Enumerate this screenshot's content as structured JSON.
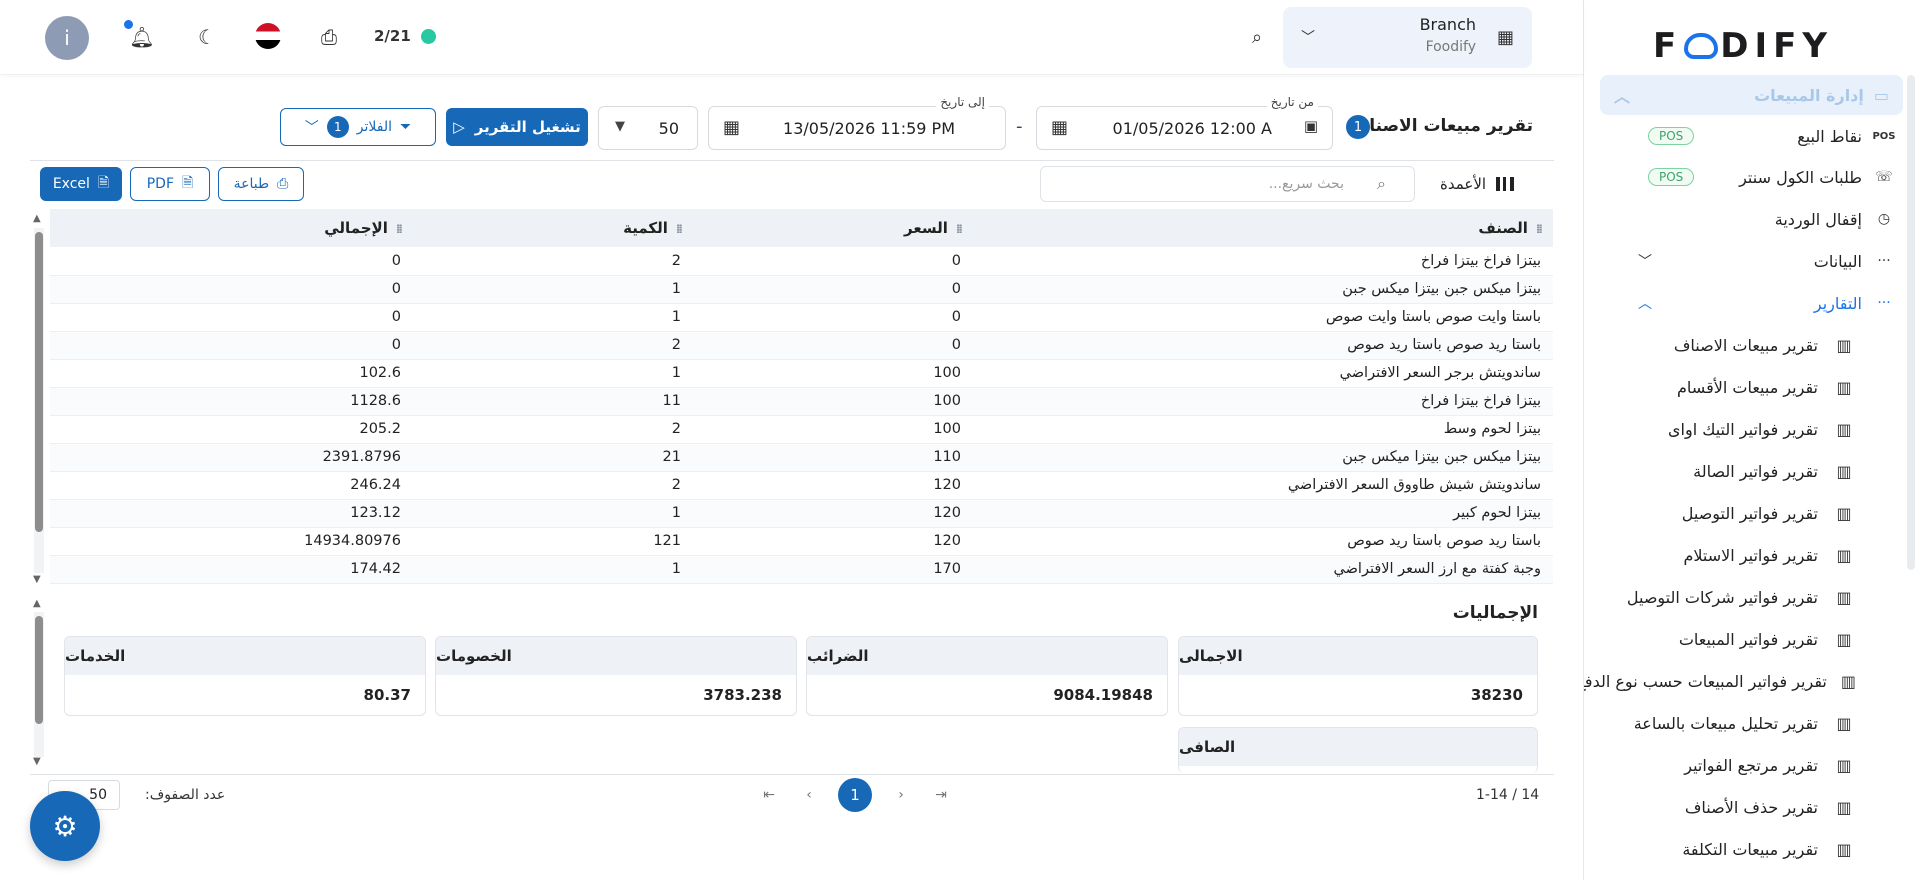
{
  "header": {
    "counter": "2/21",
    "branch_title": "Branch",
    "branch_sub": "Foodify",
    "avatar_letter": "i"
  },
  "sidebar": {
    "logo_left": "F",
    "logo_right": "DIFY",
    "section_label": "إدارة المبيعات",
    "items": [
      {
        "label": "نقاط البيع",
        "badge": "POS",
        "icon_text": "POS"
      },
      {
        "label": "طلبات الكول سنتر",
        "badge": "POS"
      },
      {
        "label": "إقفال الوردية"
      },
      {
        "label": "البيانات"
      },
      {
        "label": "التقارير"
      }
    ],
    "reports": [
      "تقرير مبيعات الاصناف",
      "تقرير مبيعات الأقسام",
      "تقرير فواتير التيك اواى",
      "تقرير فواتير الصالة",
      "تقرير فواتير التوصيل",
      "تقرير فواتير الاستلام",
      "تقرير فواتير شركات التوصيل",
      "تقرير فواتير المبيعات",
      "تقرير فواتير المبيعات حسب نوع الدفع",
      "تقرير تحليل مبيعات بالساعة",
      "تقرير مرتجع الفواتير",
      "تقرير حذف الأصناف",
      "تقرير مبيعات التكلفة"
    ]
  },
  "toolbar": {
    "page_title": "تقرير مبيعات الاصناف",
    "title_badge": "1",
    "from_label": "من تاريخ",
    "from_value": "01/05/2026 12:00 A",
    "to_label": "إلى تاريخ",
    "to_value": "13/05/2026 11:59 PM",
    "rows_value": "50",
    "run_label": "تشغيل التقرير",
    "filters_label": "الفلاتر",
    "filters_badge": "1"
  },
  "actions": {
    "excel": "Excel",
    "pdf": "PDF",
    "print": "طباعة",
    "search_placeholder": "بحث سريع...",
    "columns": "الأعمدة"
  },
  "table": {
    "headers": [
      "الصنف",
      "السعر",
      "الكمية",
      "الإجمالي"
    ],
    "rows": [
      [
        "بيتزا فراخ بيتزا فراخ",
        "0",
        "2",
        "0"
      ],
      [
        "بيتزا ميكس جبن بيتزا ميكس جبن",
        "0",
        "1",
        "0"
      ],
      [
        "باستا وايت صوص باستا وايت صوص",
        "0",
        "1",
        "0"
      ],
      [
        "باستا ريد صوص باستا ريد صوص",
        "0",
        "2",
        "0"
      ],
      [
        "ساندويتش برجر السعر الافتراضي",
        "100",
        "1",
        "102.6"
      ],
      [
        "بيتزا فراخ بيتزا فراخ",
        "100",
        "11",
        "1128.6"
      ],
      [
        "بيتزا لحوم وسط",
        "100",
        "2",
        "205.2"
      ],
      [
        "بيتزا ميكس جبن بيتزا ميكس جبن",
        "110",
        "21",
        "2391.8796"
      ],
      [
        "ساندويتش شيش طاووق السعر الافتراضي",
        "120",
        "2",
        "246.24"
      ],
      [
        "بيتزا لحوم كبير",
        "120",
        "1",
        "123.12"
      ],
      [
        "باستا ريد صوص باستا ريد صوص",
        "120",
        "121",
        "14934.80976"
      ],
      [
        "وجبة كفتة مع ارز السعر الافتراضي",
        "170",
        "1",
        "174.42"
      ]
    ]
  },
  "totals": {
    "title": "الإجماليات",
    "cards": [
      {
        "label": "الاجمالى",
        "value": "38230"
      },
      {
        "label": "الضرائب",
        "value": "9084.19848"
      },
      {
        "label": "الخصومات",
        "value": "3783.238"
      },
      {
        "label": "الخدمات",
        "value": "80.37"
      },
      {
        "label": "الصافى",
        "value": ""
      }
    ]
  },
  "footer": {
    "range": "1-14 / 14",
    "current_page": "1",
    "rows_per_page_label": "عدد الصفوف:",
    "rows_per_page_value": "50"
  },
  "colors": {
    "primary": "#1769b8",
    "online": "#28c8a0",
    "sidebar_section_bg": "#e8f1fb"
  }
}
